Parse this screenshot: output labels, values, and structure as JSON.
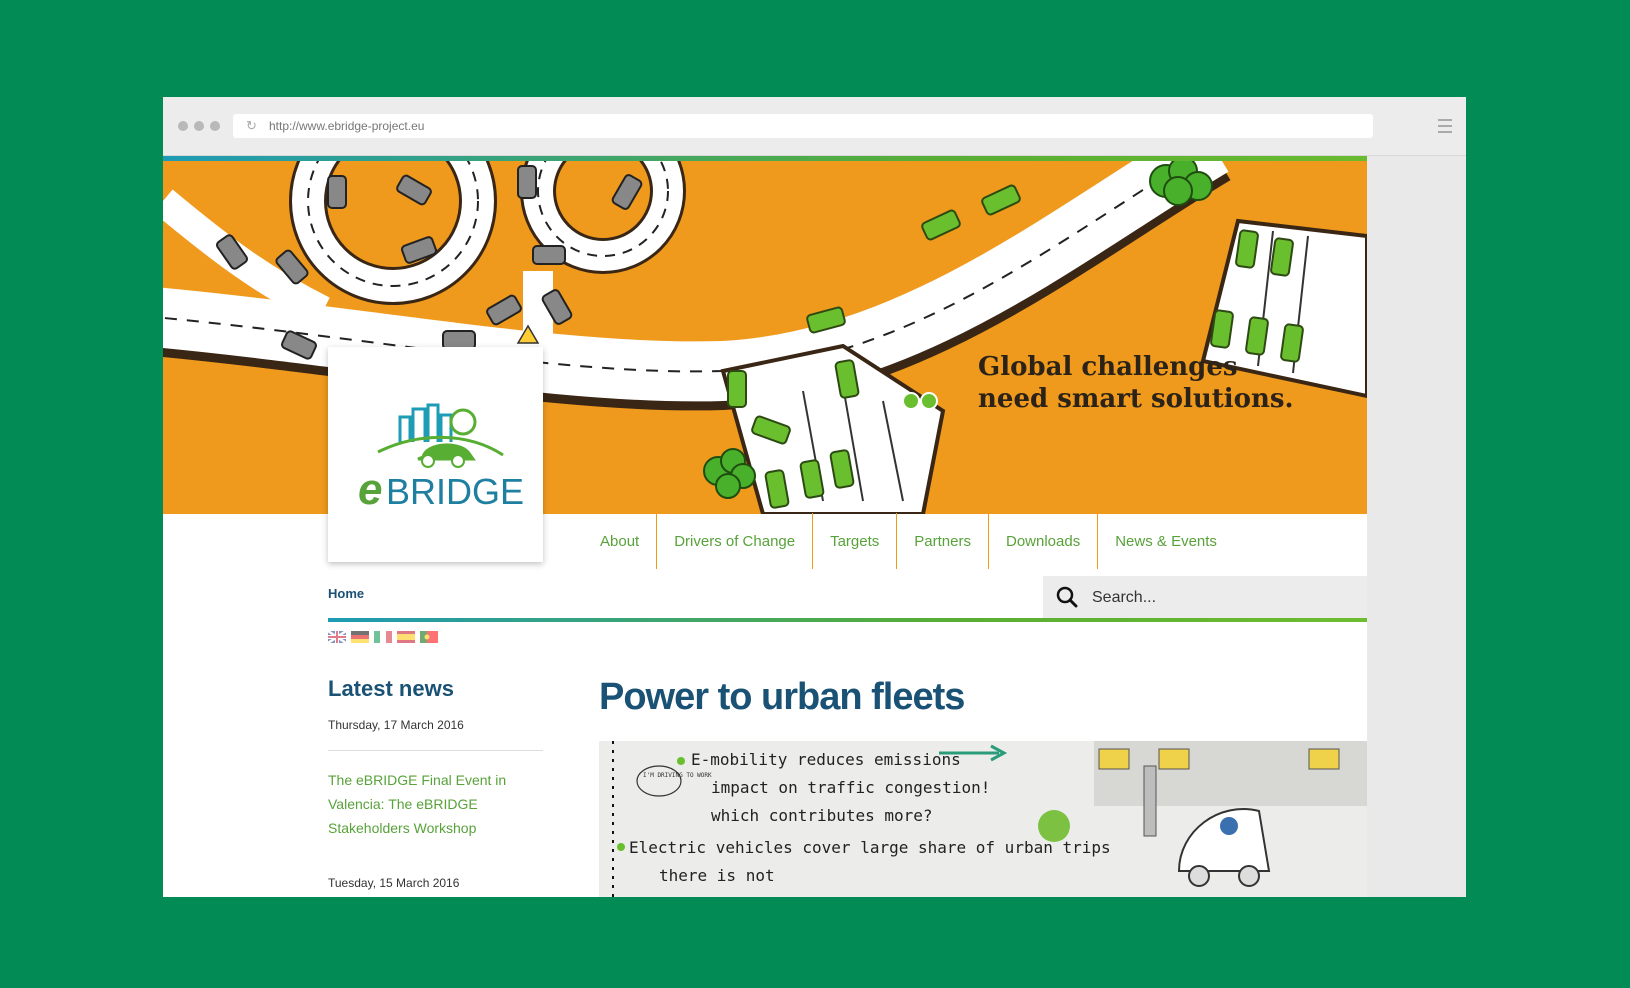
{
  "browser": {
    "url": "http://www.ebridge-project.eu"
  },
  "hero": {
    "tagline_line1": "Global challenges",
    "tagline_line2": "need smart solutions."
  },
  "logo": {
    "text_e": "e",
    "text_bridge": "BRIDGE"
  },
  "nav": {
    "items": [
      "About",
      "Drivers of Change",
      "Targets",
      "Partners",
      "Downloads",
      "News & Events"
    ]
  },
  "breadcrumb": "Home",
  "search": {
    "placeholder": "Search..."
  },
  "flags": [
    "uk-flag",
    "de-flag",
    "it-flag",
    "es-flag",
    "pt-flag"
  ],
  "sidebar": {
    "title": "Latest news",
    "news": [
      {
        "date": "Thursday, 17 March 2016",
        "title": "The eBRIDGE Final Event in Valencia: The eBRIDGE Stakeholders Workshop"
      },
      {
        "date": "Tuesday, 15 March 2016"
      }
    ]
  },
  "main": {
    "title": "Power to urban fleets",
    "sketch_lines": [
      "E-mobility reduces emissions",
      "impact on traffic congestion!",
      "which contributes more?",
      "Electric vehicles cover large share of urban trips",
      "there is not"
    ],
    "sketch_bubble": "I'M DRIVING TO WORK"
  },
  "colors": {
    "background": "#028b55",
    "hero_orange": "#ef9a1d",
    "brand_blue": "#1a5276",
    "brand_green": "#58a23a"
  }
}
